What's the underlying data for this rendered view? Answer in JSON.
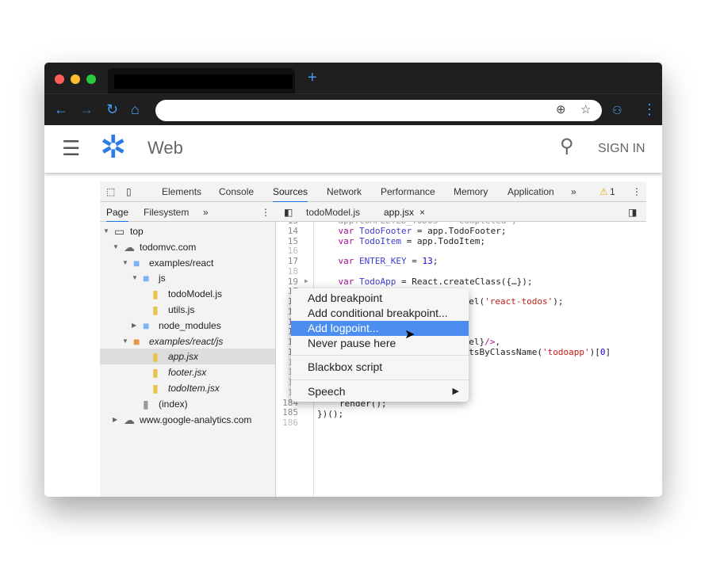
{
  "browser": {
    "new_tab": "+",
    "colors": {
      "accent": "#4a9cf5",
      "chrome": "#1f1f1f"
    }
  },
  "app": {
    "title": "Web",
    "sign_in": "SIGN IN",
    "brand_color": "#2d7be6"
  },
  "devtools": {
    "tabs": [
      "Elements",
      "Console",
      "Sources",
      "Network",
      "Performance",
      "Memory",
      "Application"
    ],
    "active_tab": "Sources",
    "more": "»",
    "warnings": "1",
    "nav_tabs": [
      "Page",
      "Filesystem"
    ],
    "editor_tabs": [
      "todoModel.js",
      "app.jsx"
    ],
    "tree": [
      {
        "label": "top"
      },
      {
        "label": "todomvc.com"
      },
      {
        "label": "examples/react"
      },
      {
        "label": "js"
      },
      {
        "label": "todoModel.js"
      },
      {
        "label": "utils.js"
      },
      {
        "label": "node_modules"
      },
      {
        "label": "examples/react/js"
      },
      {
        "label": "app.jsx"
      },
      {
        "label": "footer.jsx"
      },
      {
        "label": "todoItem.jsx"
      },
      {
        "label": "(index)"
      },
      {
        "label": "www.google-analytics.com"
      }
    ],
    "code": {
      "lines": [
        "13",
        "14",
        "15",
        "16",
        "17",
        "18",
        "19",
        "17",
        "17",
        "17",
        "17",
        "17",
        "17",
        "17",
        "18",
        "18",
        "18",
        "18",
        "184",
        "185",
        "186"
      ],
      "l14": [
        "var ",
        "TodoFooter",
        " = app.TodoFooter;"
      ],
      "l15": [
        "var ",
        "TodoItem",
        " = app.TodoItem;"
      ],
      "l17": [
        "var ",
        "ENTER_KEY",
        " = ",
        "13",
        ";"
      ],
      "l19": [
        "var ",
        "TodoApp",
        " = React.createClass({…});"
      ],
      "frag1": [
        "odel(",
        "'react-todos'",
        ");"
      ],
      "frag2": [
        "odel}",
        "/>",
        ","
      ],
      "frag3": [
        "entsByClassName(",
        "'todoapp'",
        ")[",
        "0",
        "]"
      ],
      "l184": "render();",
      "l185": "})();"
    },
    "context_menu": {
      "items": [
        "Add breakpoint",
        "Add conditional breakpoint...",
        "Add logpoint...",
        "Never pause here",
        "Blackbox script",
        "Speech"
      ],
      "highlighted": "Add logpoint...",
      "submenu_arrow": "▶"
    }
  }
}
